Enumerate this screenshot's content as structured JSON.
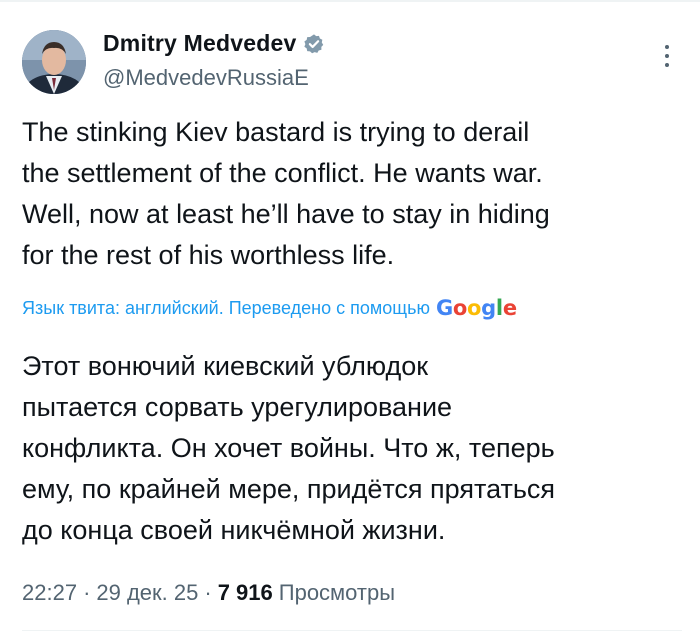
{
  "tweet": {
    "author": {
      "display_name": "Dmitry Medvedev",
      "handle": "@MedvedevRussiaE",
      "verified": true,
      "avatar_icon": "profile-photo"
    },
    "text": "The stinking Kiev bastard is trying to derail\nthe settlement of the conflict. He wants war.\nWell, now at least he’ll have to stay in hiding\nfor the rest of his worthless life.",
    "translation": {
      "label": "Язык твита: английский. Переведено с помощью",
      "provider_logo": "Google",
      "text": "Этот вонючий киевский ублюдок\nпытается сорвать урегулирование\nконфликта. Он хочет войны. Что ж, теперь\nему, по крайней мере, придётся прятаться\nдо конца своей никчёмной жизни."
    },
    "meta": {
      "time": "22:27",
      "date": "29 дек. 25",
      "views_count": "7 916",
      "views_label": "Просмотры",
      "separator": "·"
    }
  },
  "colors": {
    "accent": "#1d9bf0",
    "secondary_text": "#536471",
    "primary_text": "#0f1419"
  }
}
